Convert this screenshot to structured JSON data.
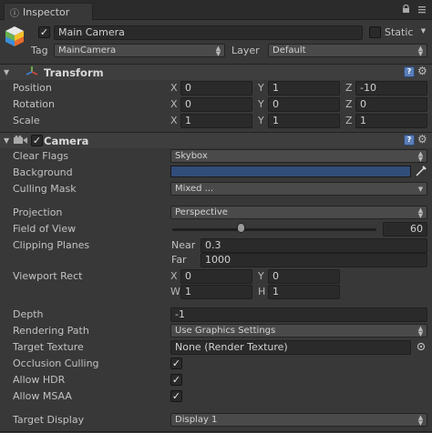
{
  "tab": {
    "label": "Inspector"
  },
  "object": {
    "name": "Main Camera",
    "active": true,
    "static_label": "Static",
    "tag_label": "Tag",
    "tag_value": "MainCamera",
    "layer_label": "Layer",
    "layer_value": "Default"
  },
  "transform": {
    "title": "Transform",
    "position": {
      "label": "Position",
      "x": "0",
      "y": "1",
      "z": "-10"
    },
    "rotation": {
      "label": "Rotation",
      "x": "0",
      "y": "0",
      "z": "0"
    },
    "scale": {
      "label": "Scale",
      "x": "1",
      "y": "1",
      "z": "1"
    },
    "axis_x": "X",
    "axis_y": "Y",
    "axis_z": "Z"
  },
  "camera": {
    "title": "Camera",
    "enabled": true,
    "clear_flags": {
      "label": "Clear Flags",
      "value": "Skybox"
    },
    "background": {
      "label": "Background",
      "color": "#314d79"
    },
    "culling_mask": {
      "label": "Culling Mask",
      "value": "Mixed ..."
    },
    "projection": {
      "label": "Projection",
      "value": "Perspective"
    },
    "fov": {
      "label": "Field of View",
      "value": "60",
      "fraction": 0.333
    },
    "clipping": {
      "label": "Clipping Planes",
      "near_label": "Near",
      "near": "0.3",
      "far_label": "Far",
      "far": "1000"
    },
    "viewport": {
      "label": "Viewport Rect",
      "x_label": "X",
      "x": "0",
      "y_label": "Y",
      "y": "0",
      "w_label": "W",
      "w": "1",
      "h_label": "H",
      "h": "1"
    },
    "depth": {
      "label": "Depth",
      "value": "-1"
    },
    "rendering_path": {
      "label": "Rendering Path",
      "value": "Use Graphics Settings"
    },
    "target_texture": {
      "label": "Target Texture",
      "value": "None (Render Texture)"
    },
    "occlusion_culling": {
      "label": "Occlusion Culling",
      "checked": true
    },
    "allow_hdr": {
      "label": "Allow HDR",
      "checked": true
    },
    "allow_msaa": {
      "label": "Allow MSAA",
      "checked": true
    },
    "target_display": {
      "label": "Target Display",
      "value": "Display 1"
    }
  },
  "icons": {
    "check": "✓",
    "book": "?",
    "gear": "⚙"
  }
}
